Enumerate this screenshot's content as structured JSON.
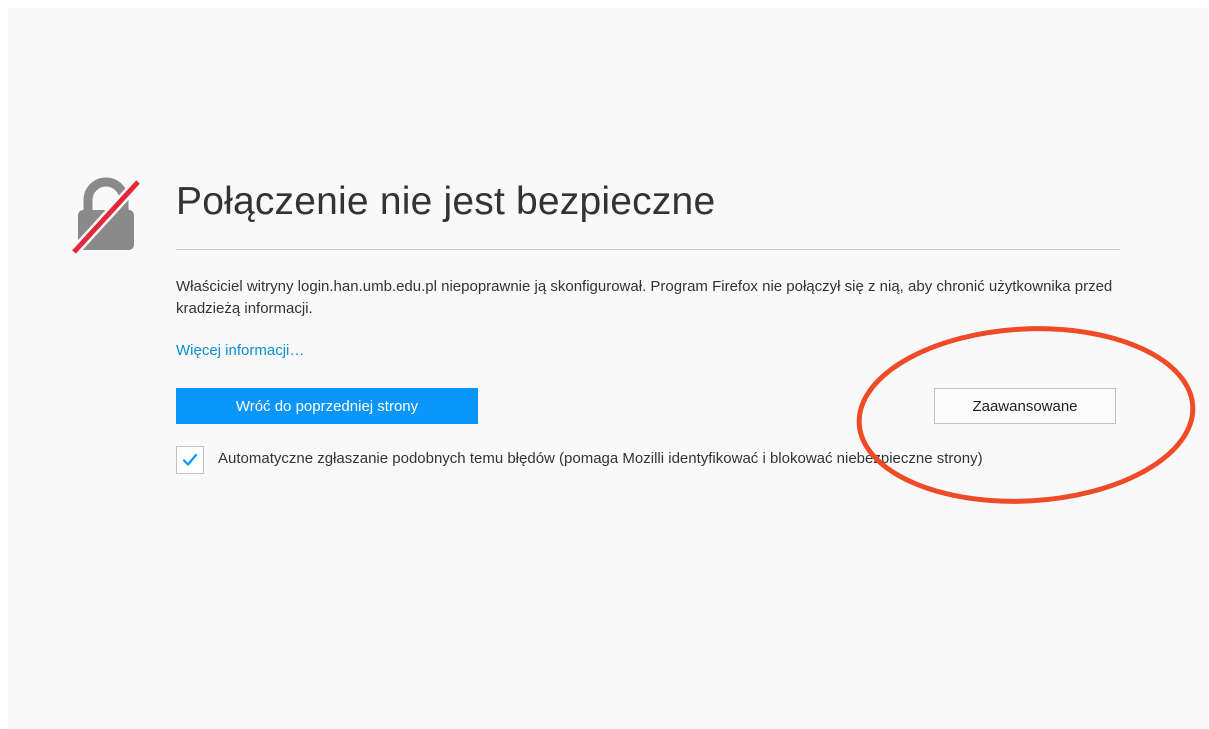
{
  "error_page": {
    "title": "Połączenie nie jest bezpieczne",
    "description": "Właściciel witryny login.han.umb.edu.pl niepoprawnie ją skonfigurował. Program Firefox nie połączył się z nią, aby chronić użytkownika przed kradzieżą informacji.",
    "more_info_link": "Więcej informacji…",
    "back_button_label": "Wróć do poprzedniej strony",
    "advanced_button_label": "Zaawansowane",
    "report_checkbox": {
      "checked": true,
      "label": "Automatyczne zgłaszanie podobnych temu błędów (pomaga Mozilli identyfikować i blokować niebezpieczne strony)"
    }
  },
  "icons": {
    "lock": "broken-lock-icon",
    "check": "checkmark-icon"
  },
  "colors": {
    "background": "#f9f9fa",
    "primary_button": "#0996f8",
    "link": "#0a8dd4",
    "lock_gray": "#8a8a8a",
    "lock_strike": "#e2283a",
    "annotation_ring": "#ef4b26"
  }
}
